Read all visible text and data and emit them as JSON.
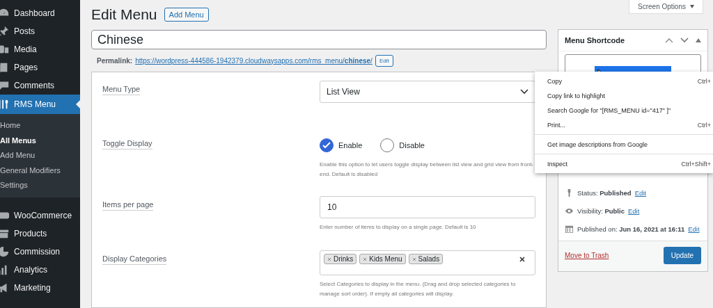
{
  "sidebar": {
    "items": [
      {
        "label": "Dashboard",
        "selected": false
      },
      {
        "label": "Posts",
        "selected": false
      },
      {
        "label": "Media",
        "selected": false
      },
      {
        "label": "Pages",
        "selected": false
      },
      {
        "label": "Comments",
        "selected": false
      },
      {
        "label": "RMS Menu",
        "selected": true,
        "children": [
          {
            "label": "Home",
            "selected": false
          },
          {
            "label": "All Menus",
            "selected": true
          },
          {
            "label": "Add Menu",
            "selected": false
          },
          {
            "label": "General Modifiers",
            "selected": false
          },
          {
            "label": "Settings",
            "selected": false
          }
        ]
      },
      {
        "label": "WooCommerce",
        "selected": false
      },
      {
        "label": "Products",
        "selected": false
      },
      {
        "label": "Commission",
        "selected": false
      },
      {
        "label": "Analytics",
        "selected": false
      },
      {
        "label": "Marketing",
        "selected": false
      }
    ]
  },
  "screen_options": "Screen Options",
  "page_title": "Edit Menu",
  "add_button": "Add Menu",
  "title_field": {
    "value": "Chinese"
  },
  "permalink": {
    "label": "Permalink:",
    "url_prefix": "https://wordpress-444586-1942379.cloudwaysapps.com/rms_menu/",
    "slug": "chinese",
    "url_suffix": "/",
    "edit": "Edit"
  },
  "settings": [
    {
      "kind": "select",
      "label": "Menu Type",
      "value": "List View"
    },
    {
      "kind": "radio",
      "label": "Toggle Display",
      "options": [
        {
          "label": "Enable",
          "selected": true
        },
        {
          "label": "Disable",
          "selected": false
        }
      ],
      "help": "Enable this option to let users toggle display between list view and grid view from front-end. Default is disabled"
    },
    {
      "kind": "input",
      "label": "Items per page",
      "value": "10",
      "help": "Enter number of items to display on a single page. Default is 10"
    },
    {
      "kind": "tags",
      "label": "Display Categories",
      "tags": [
        "Drinks",
        "Kids Menu",
        "Salads"
      ],
      "help": "Select Categories to display in the menu. (Drag and drop selected categories to manage sort order). If empty all categories will display."
    }
  ],
  "shortcode_box": {
    "title": "Menu Shortcode"
  },
  "publish": {
    "rows": [
      {
        "label": "Status:",
        "value": "Published",
        "link": "Edit"
      },
      {
        "label": "Visibility:",
        "value": "Public",
        "link": "Edit"
      },
      {
        "label": "Published on:",
        "value": "Jun 16, 2021 at 16:11",
        "link": "Edit"
      }
    ],
    "trash": "Move to Trash",
    "update": "Update"
  },
  "context_menu": {
    "groups": [
      [
        {
          "label": "Copy",
          "shortcut": "Ctrl+"
        },
        {
          "label": "Copy link to highlight"
        },
        {
          "label": "Search Google for \"[RMS_MENU id=\"417\" ]\""
        },
        {
          "label": "Print...",
          "shortcut": "Ctrl+"
        }
      ],
      [
        {
          "label": "Get image descriptions from Google"
        }
      ],
      [
        {
          "label": "Inspect",
          "shortcut": "Ctrl+Shift+"
        }
      ]
    ]
  }
}
